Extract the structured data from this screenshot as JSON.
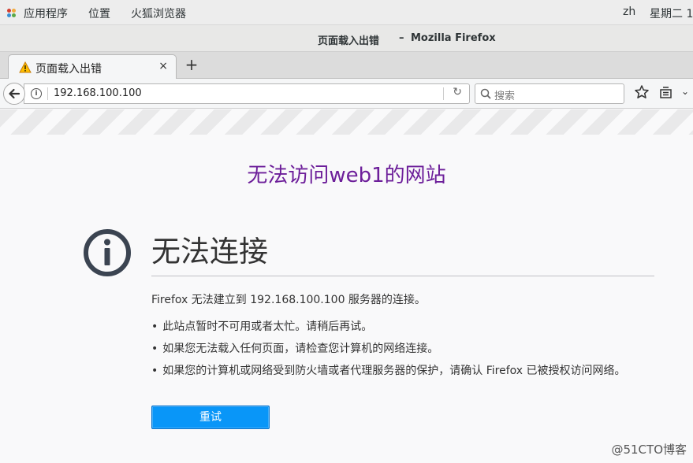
{
  "topbar": {
    "apps_label": "应用程序",
    "places_label": "位置",
    "browser_label": "火狐浏览器",
    "user": "zh",
    "clock": "星期二 1"
  },
  "window": {
    "title": "页面载入出错",
    "separator": "–",
    "app_name": "Mozilla Firefox"
  },
  "tab": {
    "label": "页面载入出错",
    "close_glyph": "×",
    "new_tab_glyph": "+"
  },
  "navbar": {
    "url": "192.168.100.100",
    "search_placeholder": "搜索",
    "reload_glyph": "↻"
  },
  "page": {
    "heading": "无法访问web1的网站",
    "error_title": "无法连接",
    "description": "Firefox 无法建立到 192.168.100.100 服务器的连接。",
    "bullets": [
      "此站点暂时不可用或者太忙。请稍后再试。",
      "如果您无法载入任何页面，请检查您计算机的网络连接。",
      "如果您的计算机或网络受到防火墙或者代理服务器的保护，请确认 Firefox 已被授权访问网络。"
    ],
    "retry_label": "重试"
  },
  "watermark": "@51CTO博客",
  "colors": {
    "heading": "#6d1f9a",
    "button": "#0996f8",
    "icon": "#3b4451"
  }
}
